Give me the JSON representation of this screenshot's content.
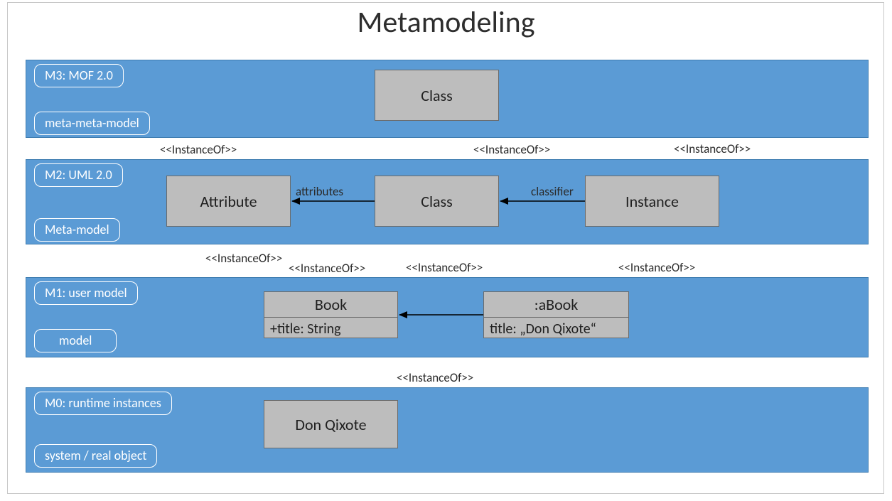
{
  "title": "Metamodeling",
  "stereo": {
    "instanceOf": "<<InstanceOf>>"
  },
  "assoc": {
    "attributes": "attributes",
    "classifier": "classifier"
  },
  "layers": {
    "m3": {
      "level": "M3: MOF 2.0",
      "kind": "meta-meta-model",
      "boxes": {
        "class": "Class"
      }
    },
    "m2": {
      "level": "M2: UML 2.0",
      "kind": "Meta-model",
      "boxes": {
        "attribute": "Attribute",
        "class": "Class",
        "instance": "Instance"
      }
    },
    "m1": {
      "level": "M1: user model",
      "kind": "model",
      "book": {
        "head": "Book",
        "attr": "+title: String"
      },
      "abook": {
        "head": ":aBook",
        "attr": "title: „Don Qixote“"
      }
    },
    "m0": {
      "level": "M0: runtime instances",
      "kind": "system / real object",
      "boxes": {
        "object": "Don Qixote"
      }
    }
  }
}
